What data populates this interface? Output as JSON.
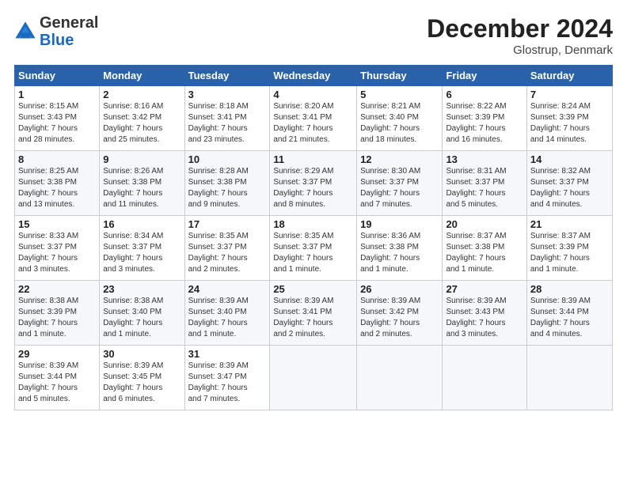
{
  "header": {
    "logo_general": "General",
    "logo_blue": "Blue",
    "month_title": "December 2024",
    "location": "Glostrup, Denmark"
  },
  "days_of_week": [
    "Sunday",
    "Monday",
    "Tuesday",
    "Wednesday",
    "Thursday",
    "Friday",
    "Saturday"
  ],
  "weeks": [
    [
      {
        "day": "1",
        "info": "Sunrise: 8:15 AM\nSunset: 3:43 PM\nDaylight: 7 hours\nand 28 minutes."
      },
      {
        "day": "2",
        "info": "Sunrise: 8:16 AM\nSunset: 3:42 PM\nDaylight: 7 hours\nand 25 minutes."
      },
      {
        "day": "3",
        "info": "Sunrise: 8:18 AM\nSunset: 3:41 PM\nDaylight: 7 hours\nand 23 minutes."
      },
      {
        "day": "4",
        "info": "Sunrise: 8:20 AM\nSunset: 3:41 PM\nDaylight: 7 hours\nand 21 minutes."
      },
      {
        "day": "5",
        "info": "Sunrise: 8:21 AM\nSunset: 3:40 PM\nDaylight: 7 hours\nand 18 minutes."
      },
      {
        "day": "6",
        "info": "Sunrise: 8:22 AM\nSunset: 3:39 PM\nDaylight: 7 hours\nand 16 minutes."
      },
      {
        "day": "7",
        "info": "Sunrise: 8:24 AM\nSunset: 3:39 PM\nDaylight: 7 hours\nand 14 minutes."
      }
    ],
    [
      {
        "day": "8",
        "info": "Sunrise: 8:25 AM\nSunset: 3:38 PM\nDaylight: 7 hours\nand 13 minutes."
      },
      {
        "day": "9",
        "info": "Sunrise: 8:26 AM\nSunset: 3:38 PM\nDaylight: 7 hours\nand 11 minutes."
      },
      {
        "day": "10",
        "info": "Sunrise: 8:28 AM\nSunset: 3:38 PM\nDaylight: 7 hours\nand 9 minutes."
      },
      {
        "day": "11",
        "info": "Sunrise: 8:29 AM\nSunset: 3:37 PM\nDaylight: 7 hours\nand 8 minutes."
      },
      {
        "day": "12",
        "info": "Sunrise: 8:30 AM\nSunset: 3:37 PM\nDaylight: 7 hours\nand 7 minutes."
      },
      {
        "day": "13",
        "info": "Sunrise: 8:31 AM\nSunset: 3:37 PM\nDaylight: 7 hours\nand 5 minutes."
      },
      {
        "day": "14",
        "info": "Sunrise: 8:32 AM\nSunset: 3:37 PM\nDaylight: 7 hours\nand 4 minutes."
      }
    ],
    [
      {
        "day": "15",
        "info": "Sunrise: 8:33 AM\nSunset: 3:37 PM\nDaylight: 7 hours\nand 3 minutes."
      },
      {
        "day": "16",
        "info": "Sunrise: 8:34 AM\nSunset: 3:37 PM\nDaylight: 7 hours\nand 3 minutes."
      },
      {
        "day": "17",
        "info": "Sunrise: 8:35 AM\nSunset: 3:37 PM\nDaylight: 7 hours\nand 2 minutes."
      },
      {
        "day": "18",
        "info": "Sunrise: 8:35 AM\nSunset: 3:37 PM\nDaylight: 7 hours\nand 1 minute."
      },
      {
        "day": "19",
        "info": "Sunrise: 8:36 AM\nSunset: 3:38 PM\nDaylight: 7 hours\nand 1 minute."
      },
      {
        "day": "20",
        "info": "Sunrise: 8:37 AM\nSunset: 3:38 PM\nDaylight: 7 hours\nand 1 minute."
      },
      {
        "day": "21",
        "info": "Sunrise: 8:37 AM\nSunset: 3:39 PM\nDaylight: 7 hours\nand 1 minute."
      }
    ],
    [
      {
        "day": "22",
        "info": "Sunrise: 8:38 AM\nSunset: 3:39 PM\nDaylight: 7 hours\nand 1 minute."
      },
      {
        "day": "23",
        "info": "Sunrise: 8:38 AM\nSunset: 3:40 PM\nDaylight: 7 hours\nand 1 minute."
      },
      {
        "day": "24",
        "info": "Sunrise: 8:39 AM\nSunset: 3:40 PM\nDaylight: 7 hours\nand 1 minute."
      },
      {
        "day": "25",
        "info": "Sunrise: 8:39 AM\nSunset: 3:41 PM\nDaylight: 7 hours\nand 2 minutes."
      },
      {
        "day": "26",
        "info": "Sunrise: 8:39 AM\nSunset: 3:42 PM\nDaylight: 7 hours\nand 2 minutes."
      },
      {
        "day": "27",
        "info": "Sunrise: 8:39 AM\nSunset: 3:43 PM\nDaylight: 7 hours\nand 3 minutes."
      },
      {
        "day": "28",
        "info": "Sunrise: 8:39 AM\nSunset: 3:44 PM\nDaylight: 7 hours\nand 4 minutes."
      }
    ],
    [
      {
        "day": "29",
        "info": "Sunrise: 8:39 AM\nSunset: 3:44 PM\nDaylight: 7 hours\nand 5 minutes."
      },
      {
        "day": "30",
        "info": "Sunrise: 8:39 AM\nSunset: 3:45 PM\nDaylight: 7 hours\nand 6 minutes."
      },
      {
        "day": "31",
        "info": "Sunrise: 8:39 AM\nSunset: 3:47 PM\nDaylight: 7 hours\nand 7 minutes."
      },
      null,
      null,
      null,
      null
    ]
  ]
}
